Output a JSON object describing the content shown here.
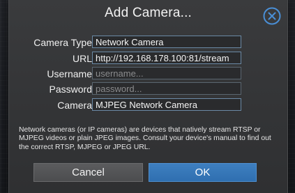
{
  "dialog": {
    "title": "Add Camera...",
    "close_icon": "close-circle-icon"
  },
  "form": {
    "camera_type": {
      "label": "Camera Type",
      "value": "Network Camera"
    },
    "url": {
      "label": "URL",
      "value": "http://192.168.178.100:81/stream"
    },
    "username": {
      "label": "Username",
      "value": "",
      "placeholder": "username..."
    },
    "password": {
      "label": "Password",
      "value": "",
      "placeholder": "password..."
    },
    "camera": {
      "label": "Camera",
      "value": "MJPEG Network Camera"
    }
  },
  "help_text": "Network cameras (or IP cameras) are devices that natively stream RTSP or MJPEG videos or plain JPEG images. Consult your device's manual to find out the correct RTSP, MJPEG or JPEG URL.",
  "buttons": {
    "cancel": "Cancel",
    "ok": "OK"
  },
  "colors": {
    "accent": "#3a7bbf",
    "dialog_bg": "#353638",
    "field_border": "#6b8aa6"
  }
}
